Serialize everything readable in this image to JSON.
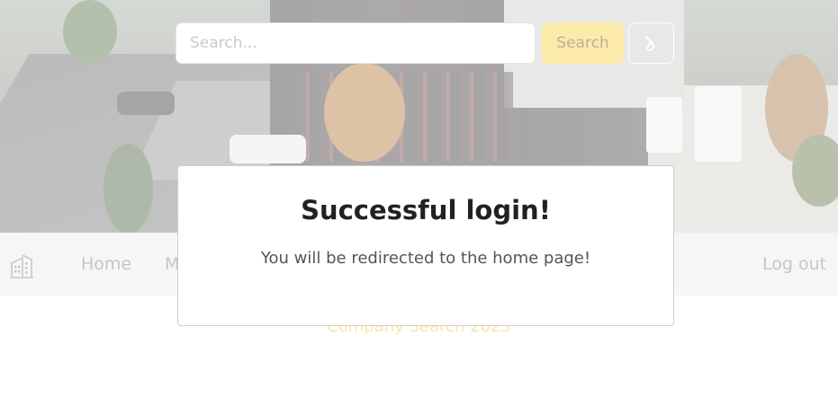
{
  "search": {
    "placeholder": "Search...",
    "button_label": "Search",
    "theme_icon": "paint-brush-icon"
  },
  "navbar": {
    "logo_icon": "building-icon",
    "links": [
      {
        "label": "Home"
      },
      {
        "label": "M"
      }
    ],
    "logout_label": "Log out"
  },
  "footer": {
    "text": "Company Search 2023"
  },
  "modal": {
    "title": "Successful login!",
    "message": "You will be redirected to the home page!"
  },
  "colors": {
    "accent": "#fbeaa9",
    "footer_text": "#fbe6a6",
    "nav_background": "#f6f6f6"
  }
}
